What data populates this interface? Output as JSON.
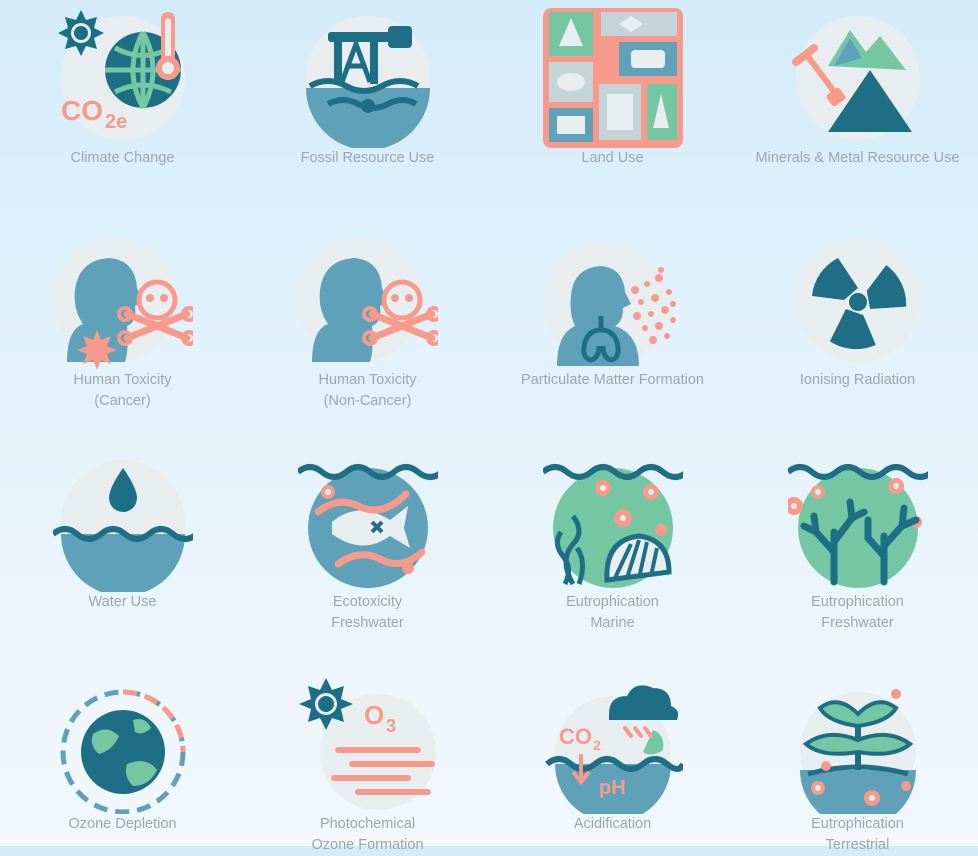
{
  "colors": {
    "teal": "#5fa1b8",
    "dark_teal": "#1e6f85",
    "coral": "#f79a8c",
    "mint": "#74c7a2",
    "circle_bg": "#e8eef0",
    "label": "#9aa8ae"
  },
  "categories": [
    {
      "icon": "climate-change-icon",
      "line1": "Climate Change",
      "line2": ""
    },
    {
      "icon": "fossil-resource-use-icon",
      "line1": "Fossil Resource Use",
      "line2": ""
    },
    {
      "icon": "land-use-icon",
      "line1": "Land Use",
      "line2": ""
    },
    {
      "icon": "minerals-metal-icon",
      "line1": "Minerals & Metal Resource Use",
      "line2": ""
    },
    {
      "icon": "human-toxicity-cancer-icon",
      "line1": "Human Toxicity",
      "line2": "(Cancer)"
    },
    {
      "icon": "human-toxicity-non-cancer-icon",
      "line1": "Human Toxicity",
      "line2": "(Non-Cancer)"
    },
    {
      "icon": "particulate-matter-icon",
      "line1": "Particulate Matter Formation",
      "line2": ""
    },
    {
      "icon": "radiation-icon",
      "line1": "Ionising Radiation",
      "line2": ""
    },
    {
      "icon": "water-drop-icon",
      "line1": "Water Use",
      "line2": ""
    },
    {
      "icon": "fish-icon",
      "line1": "Ecotoxicity",
      "line2": "Freshwater"
    },
    {
      "icon": "marine-shell-icon",
      "line1": "Eutrophication",
      "line2": "Marine"
    },
    {
      "icon": "freshwater-coral-icon",
      "line1": "Eutrophication",
      "line2": "Freshwater"
    },
    {
      "icon": "globe-ozone-icon",
      "line1": "Ozone Depletion",
      "line2": ""
    },
    {
      "icon": "sun-ozone-icon",
      "line1": "Photochemical",
      "line2": "Ozone Formation"
    },
    {
      "icon": "cloud-ph-icon",
      "line1": "Acidification",
      "line2": ""
    },
    {
      "icon": "terrestrial-plant-icon",
      "line1": "Eutrophication",
      "line2": "Terrestrial"
    }
  ]
}
